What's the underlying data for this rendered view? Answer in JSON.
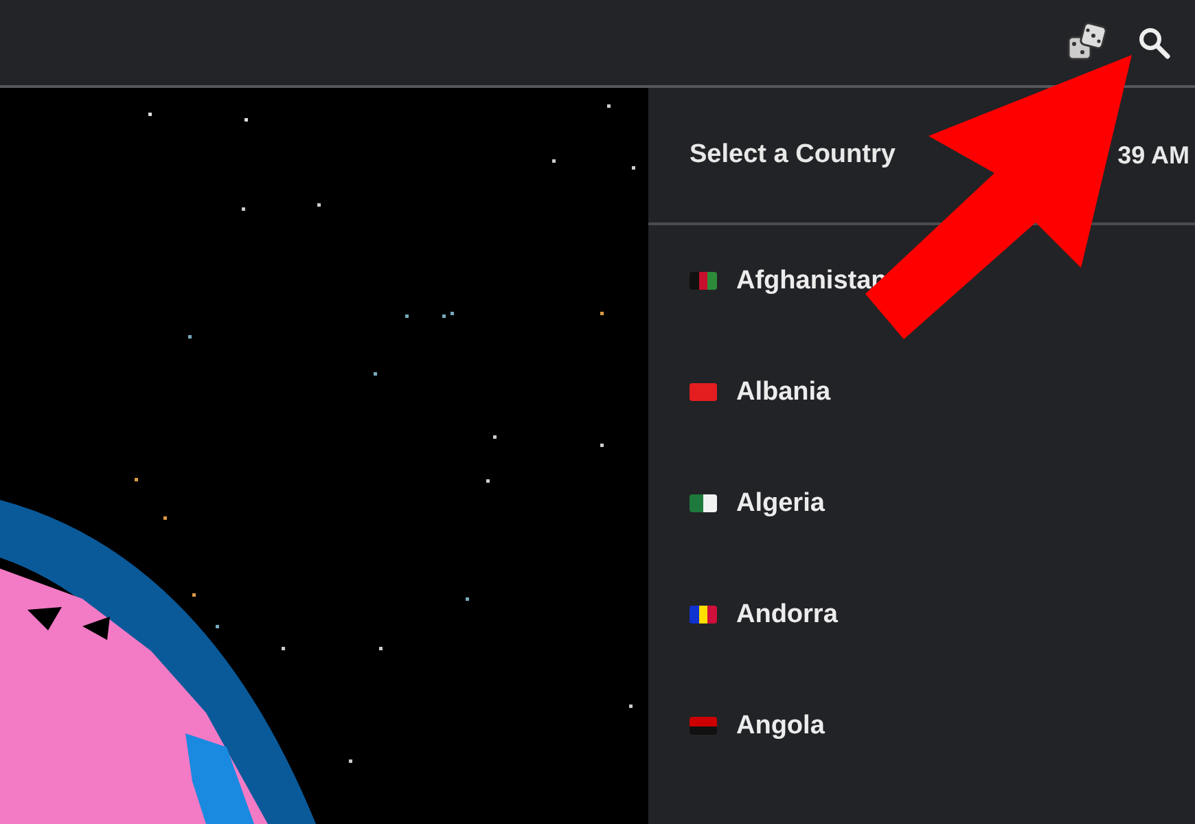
{
  "panel": {
    "title": "Select a Country",
    "time": "39 AM"
  },
  "countries": [
    {
      "name": "Afghanistan",
      "kind": "vertical",
      "flag": [
        {
          "color": "#111111"
        },
        {
          "color": "#c8102e"
        },
        {
          "color": "#2e8b3a"
        }
      ]
    },
    {
      "name": "Albania",
      "kind": "vertical",
      "flag": [
        {
          "color": "#e41e20"
        }
      ]
    },
    {
      "name": "Algeria",
      "kind": "vertical",
      "flag": [
        {
          "color": "#1e7a3c"
        },
        {
          "color": "#f2f2f2"
        }
      ]
    },
    {
      "name": "Andorra",
      "kind": "vertical",
      "flag": [
        {
          "color": "#1032cf"
        },
        {
          "color": "#fedf00"
        },
        {
          "color": "#d0103a"
        }
      ]
    },
    {
      "name": "Angola",
      "kind": "horizontal",
      "flag": [
        {
          "color": "#cc0000"
        },
        {
          "color": "#111111"
        }
      ]
    }
  ]
}
